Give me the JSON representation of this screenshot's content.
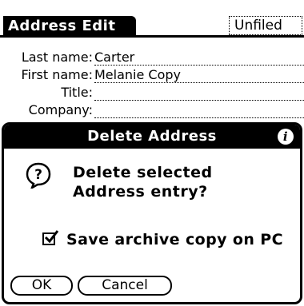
{
  "header": {
    "title": "Address Edit",
    "category": "Unfiled"
  },
  "fields": [
    {
      "label": "Last name:",
      "value": "Carter"
    },
    {
      "label": "First name:",
      "value": "Melanie Copy"
    },
    {
      "label": "Title:",
      "value": ""
    },
    {
      "label": "Company:",
      "value": ""
    }
  ],
  "dialog": {
    "title": "Delete Address",
    "info_icon": "i",
    "message_line1": "Delete selected",
    "message_line2": "Address entry?",
    "checkbox_label": "Save archive copy on PC",
    "checkbox_checked": true,
    "ok_label": "OK",
    "cancel_label": "Cancel"
  }
}
